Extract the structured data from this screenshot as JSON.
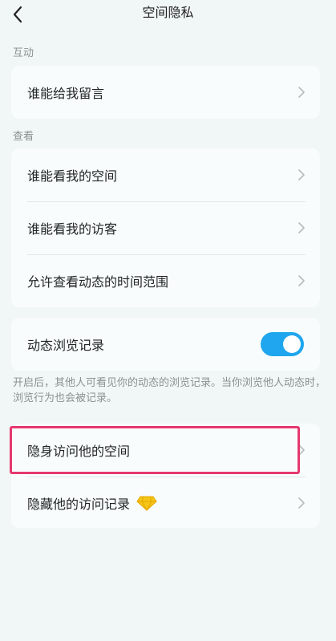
{
  "header": {
    "title": "空间隐私"
  },
  "sections": {
    "interaction": {
      "label": "互动",
      "items": [
        {
          "label": "谁能给我留言"
        }
      ]
    },
    "view": {
      "label": "查看",
      "items": [
        {
          "label": "谁能看我的空间"
        },
        {
          "label": "谁能看我的访客"
        },
        {
          "label": "允许查看动态的时间范围"
        }
      ]
    },
    "browse_record": {
      "label": "动态浏览记录",
      "enabled": true,
      "note": "开启后，其他人可看见你的动态的浏览记录。当你浏览他人动态时，浏览行为也会被记录。"
    },
    "visit": {
      "items": [
        {
          "label": "隐身访问他的空间"
        },
        {
          "label": "隐藏他的访问记录"
        }
      ]
    }
  },
  "colors": {
    "background": "#f1f7f6",
    "card": "#f9fcfc",
    "toggle_on": "#1fa6ee",
    "highlight": "#e6386f",
    "gem": "#f5c518"
  },
  "icons": {
    "back": "chevron-left-icon",
    "arrow": "chevron-right-icon",
    "vip": "diamond-icon"
  }
}
